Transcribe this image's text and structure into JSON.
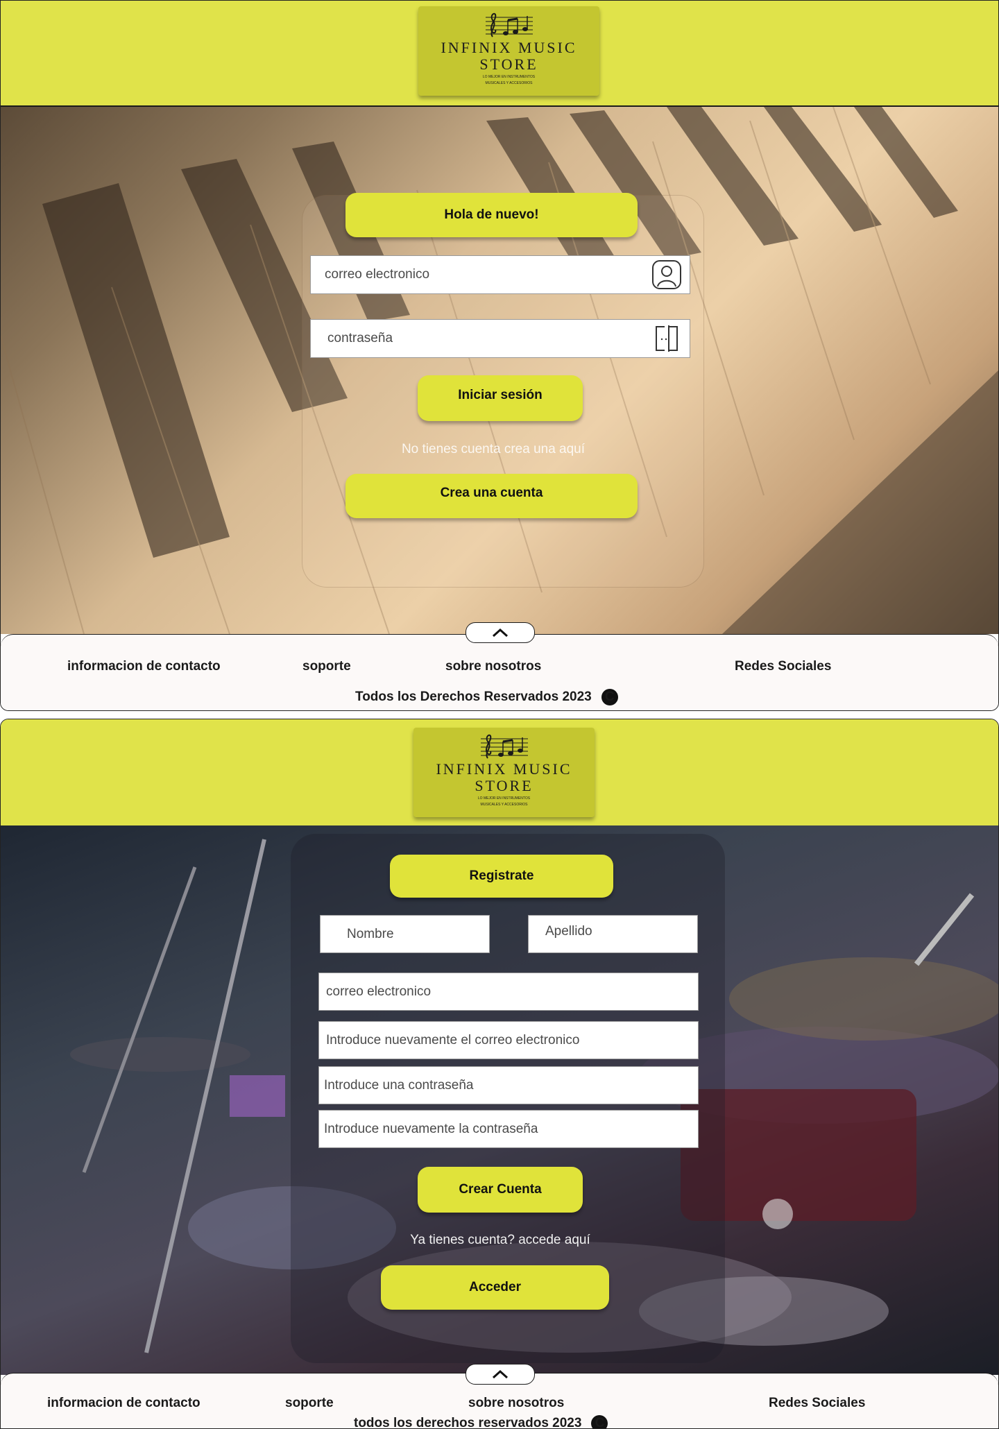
{
  "colors": {
    "accent": "#e0e33a",
    "header": "#e0e34a",
    "logo_bg": "#c4c630",
    "footer": "#fcf9f8"
  },
  "logo": {
    "brand_line1": "INFINIX MUSIC",
    "brand_line2": "STORE",
    "tagline_1": "LO MEJOR EN INSTRUMENTOS",
    "tagline_2": "MUSICALES Y ACCESORIOS",
    "icon": "music-notes-icon"
  },
  "login": {
    "title": "Hola de nuevo!",
    "email_placeholder": "correo electronico",
    "password_placeholder": "contraseña",
    "submit": "Iniciar sesión",
    "no_account_text": "No tienes cuenta crea una aquí",
    "create_button": "Crea una cuenta",
    "email_icon": "user-icon",
    "password_icon": "lock-icon"
  },
  "register": {
    "title": "Registrate",
    "first_name_placeholder": "Nombre",
    "last_name_placeholder": "Apellido",
    "email_placeholder": "correo electronico",
    "email_confirm_placeholder": "Introduce nuevamente el correo electronico",
    "password_placeholder": "Introduce una contraseña",
    "password_confirm_placeholder": "Introduce nuevamente la contraseña",
    "submit": "Crear Cuenta",
    "have_account_text": "Ya tienes cuenta? accede aquí",
    "login_button": "Acceder"
  },
  "footer1": {
    "contact": "informacion de contacto",
    "support": "soporte",
    "about": "sobre nosotros",
    "social": "Redes Sociales",
    "copyright": "Todos los Derechos Reservados  2023",
    "copyright_symbol": "C",
    "up_icon": "chevron-up-icon"
  },
  "footer2": {
    "contact": "informacion de contacto",
    "support": "soporte",
    "about": "sobre nosotros",
    "social": "Redes Sociales",
    "copyright": "todos los derechos reservados  2023",
    "copyright_symbol": "C",
    "up_icon": "chevron-up-icon"
  }
}
